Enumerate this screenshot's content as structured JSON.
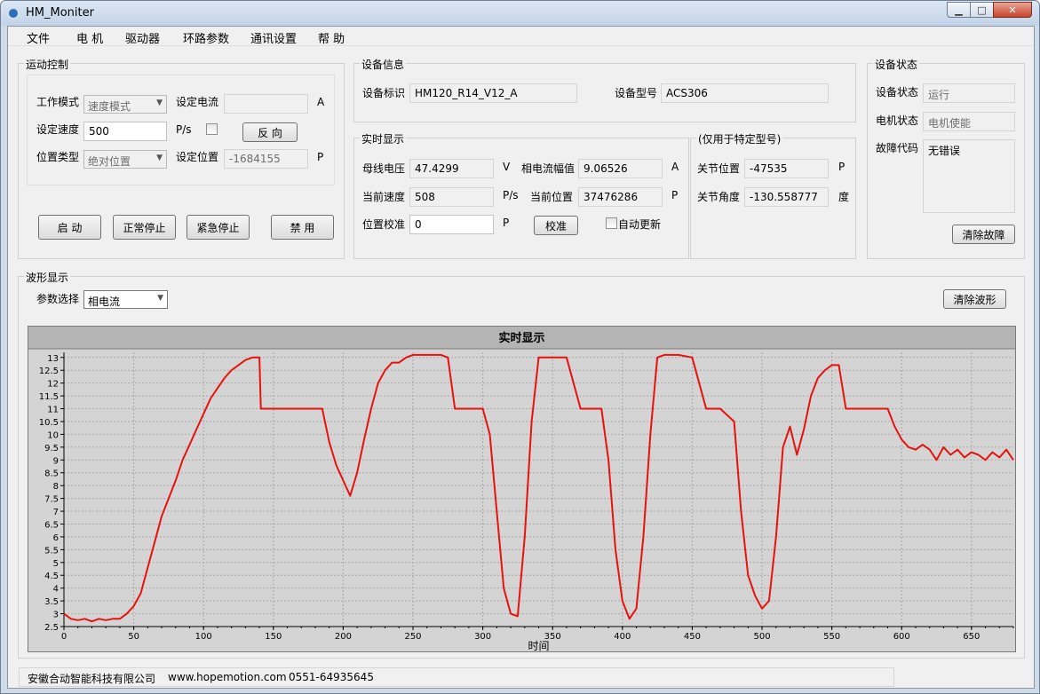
{
  "window": {
    "title": "HM_Moniter"
  },
  "menu": [
    "文件",
    "电 机",
    "驱动器",
    "环路参数",
    "通讯设置",
    "帮 助"
  ],
  "motion": {
    "group": "运动控制",
    "mode_label": "工作模式",
    "mode_value": "速度模式",
    "set_current_label": "设定电流",
    "set_current_value": "",
    "set_current_unit": "A",
    "set_speed_label": "设定速度",
    "set_speed_value": "500",
    "set_speed_unit": "P/s",
    "reverse_button": "反 向",
    "pos_type_label": "位置类型",
    "pos_type_value": "绝对位置",
    "set_pos_label": "设定位置",
    "set_pos_value": "-1684155",
    "set_pos_unit": "P",
    "buttons": [
      "启 动",
      "正常停止",
      "紧急停止",
      "禁 用"
    ]
  },
  "devinfo": {
    "group": "设备信息",
    "id_label": "设备标识",
    "id_value": "HM120_R14_V12_A",
    "model_label": "设备型号",
    "model_value": "ACS306"
  },
  "realtime": {
    "group": "实时显示",
    "bus_voltage_label": "母线电压",
    "bus_voltage_value": "47.4299",
    "bus_voltage_unit": "V",
    "phase_current_label": "相电流幅值",
    "phase_current_value": "9.06526",
    "phase_current_unit": "A",
    "speed_label": "当前速度",
    "speed_value": "508",
    "speed_unit": "P/s",
    "position_label": "当前位置",
    "position_value": "37476286",
    "position_unit": "P",
    "calib_label": "位置校准",
    "calib_value": "0",
    "calib_unit": "P",
    "calib_button": "校准",
    "auto_update_label": "自动更新"
  },
  "special": {
    "group": "(仅用于特定型号)",
    "joint_pos_label": "关节位置",
    "joint_pos_value": "-47535",
    "joint_pos_unit": "P",
    "joint_angle_label": "关节角度",
    "joint_angle_value": "-130.558777",
    "joint_angle_unit": "度"
  },
  "devstatus": {
    "group": "设备状态",
    "status_label": "设备状态",
    "status_value": "运行",
    "motor_label": "电机状态",
    "motor_value": "电机使能",
    "fault_label": "故障代码",
    "fault_value": "无错误",
    "clear_fault_button": "清除故障"
  },
  "waveform": {
    "group": "波形显示",
    "param_label": "参数选择",
    "param_value": "相电流",
    "clear_button": "清除波形"
  },
  "chart_data": {
    "type": "line",
    "title": "实时显示",
    "xlabel": "时间",
    "ylabel": "",
    "xlim": [
      0,
      680
    ],
    "ylim": [
      2.5,
      13.2
    ],
    "xticks": [
      0,
      50,
      100,
      150,
      200,
      250,
      300,
      350,
      400,
      450,
      500,
      550,
      600,
      650
    ],
    "yticks": [
      2.5,
      3,
      3.5,
      4,
      4.5,
      5,
      5.5,
      6,
      6.5,
      7,
      7.5,
      8,
      8.5,
      9,
      9.5,
      10,
      10.5,
      11,
      11.5,
      12,
      12.5,
      13
    ],
    "grid": true,
    "color": "#e8120c",
    "series": [
      {
        "x": [
          0,
          5,
          10,
          15,
          20,
          25,
          30,
          35,
          40,
          45,
          50,
          55,
          60,
          65,
          70,
          75,
          80,
          85,
          90,
          95,
          100,
          105,
          110,
          115,
          120,
          125,
          130,
          135,
          140,
          141,
          150,
          160,
          170,
          180,
          185,
          190,
          195,
          200,
          205,
          210,
          215,
          220,
          225,
          230,
          235,
          240,
          245,
          250,
          255,
          260,
          265,
          270,
          275,
          280,
          290,
          300,
          305,
          310,
          315,
          320,
          325,
          330,
          335,
          340,
          345,
          350,
          360,
          370,
          380,
          385,
          390,
          395,
          400,
          405,
          410,
          415,
          420,
          425,
          430,
          440,
          450,
          460,
          470,
          480,
          485,
          490,
          495,
          500,
          505,
          510,
          515,
          520,
          525,
          530,
          535,
          540,
          545,
          550,
          555,
          560,
          570,
          580,
          590,
          595,
          600,
          605,
          610,
          615,
          620,
          625,
          630,
          635,
          640,
          645,
          650,
          655,
          660,
          665,
          670,
          675,
          680
        ],
        "y": [
          3.0,
          2.8,
          2.75,
          2.8,
          2.7,
          2.8,
          2.75,
          2.8,
          2.8,
          3.0,
          3.3,
          3.8,
          4.8,
          5.8,
          6.8,
          7.5,
          8.2,
          9.0,
          9.6,
          10.2,
          10.8,
          11.4,
          11.8,
          12.2,
          12.5,
          12.7,
          12.9,
          13.0,
          13.0,
          11.0,
          11.0,
          11.0,
          11.0,
          11.0,
          11.0,
          9.7,
          8.8,
          8.2,
          7.6,
          8.5,
          9.8,
          11.0,
          12.0,
          12.5,
          12.8,
          12.8,
          13.0,
          13.1,
          13.1,
          13.1,
          13.1,
          13.1,
          13.0,
          11.0,
          11.0,
          11.0,
          10.0,
          7.0,
          4.0,
          3.0,
          2.9,
          6.0,
          10.5,
          13.0,
          13.0,
          13.0,
          13.0,
          11.0,
          11.0,
          11.0,
          9.0,
          5.5,
          3.5,
          2.8,
          3.2,
          6.0,
          10.0,
          13.0,
          13.1,
          13.1,
          13.0,
          11.0,
          11.0,
          10.5,
          7.0,
          4.5,
          3.7,
          3.2,
          3.5,
          6.0,
          9.5,
          10.3,
          9.2,
          10.2,
          11.5,
          12.2,
          12.5,
          12.7,
          12.7,
          11.0,
          11.0,
          11.0,
          11.0,
          10.3,
          9.8,
          9.5,
          9.4,
          9.6,
          9.4,
          9.0,
          9.5,
          9.2,
          9.4,
          9.1,
          9.3,
          9.2,
          9.0,
          9.3,
          9.1,
          9.4,
          9.0
        ]
      }
    ]
  },
  "status": {
    "company": "安徽合动智能科技有限公司",
    "website": "www.hopemotion.com",
    "phone": "0551-64935645"
  }
}
